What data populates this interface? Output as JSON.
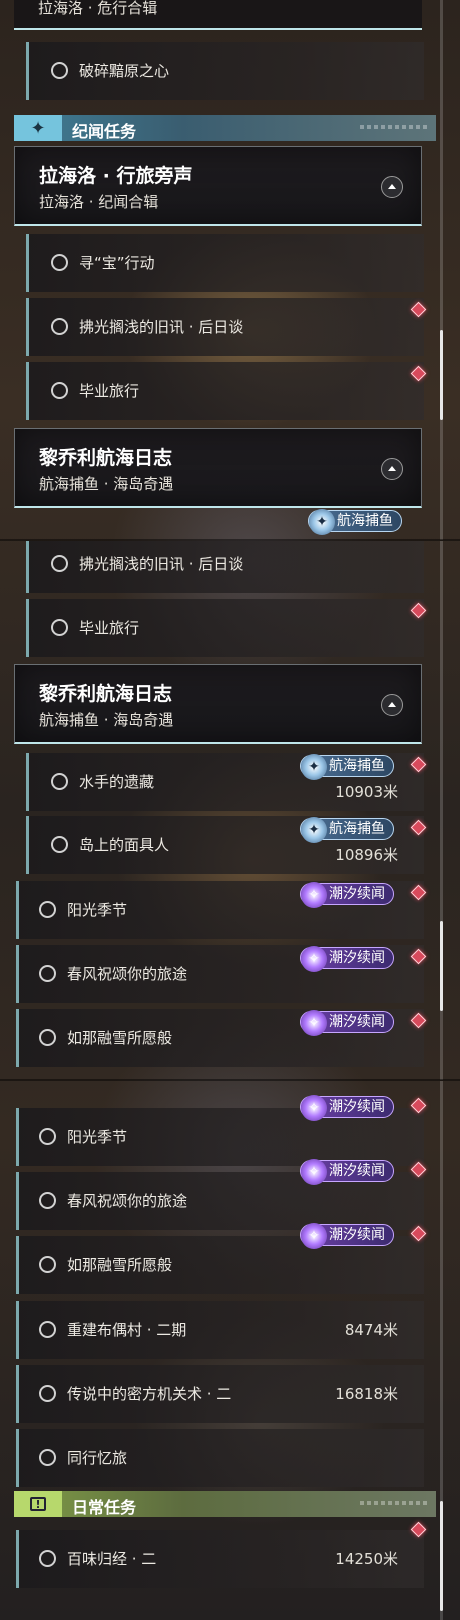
{
  "colors": {
    "accent_teal": "#bfe6ea",
    "marker_red": "#d84a5c",
    "tag_purple": "#6b3fa6",
    "tag_blue": "#4b6f95",
    "section_blue": "#75c4dd",
    "section_green": "#b7d86c"
  },
  "seg1": {
    "top_partial_subtitle": "拉海洛 · 危行合辑",
    "row_broken": "破碎黯原之心",
    "section_jiwen": "纪闻任务",
    "quest1": {
      "title": "拉海洛 · 行旅旁声",
      "subtitle": "拉海洛 · 纪闻合辑"
    },
    "rows": [
      "寻“宝”行动",
      "拂光搁浅的旧讯 · 后日谈",
      "毕业旅行"
    ],
    "quest2": {
      "title": "黎乔利航海日志",
      "subtitle": "航海捕鱼 · 海岛奇遇"
    },
    "partial_tag": "航海捕鱼"
  },
  "seg2": {
    "rows_top": [
      "拂光搁浅的旧讯 · 后日谈",
      "毕业旅行"
    ],
    "quest": {
      "title": "黎乔利航海日志",
      "subtitle": "航海捕鱼 · 海岛奇遇"
    },
    "fishing": [
      {
        "label": "水手的遗藏",
        "tag": "航海捕鱼",
        "distance": "10903米"
      },
      {
        "label": "岛上的面具人",
        "tag": "航海捕鱼",
        "distance": "10896米"
      }
    ],
    "tide": [
      {
        "label": "阳光季节",
        "tag": "潮汐续闻"
      },
      {
        "label": "春风祝颂你的旅途",
        "tag": "潮汐续闻"
      },
      {
        "label": "如那融雪所愿般",
        "tag": "潮汐续闻"
      }
    ]
  },
  "seg3": {
    "tide": [
      {
        "label": "阳光季节",
        "tag": "潮汐续闻"
      },
      {
        "label": "春风祝颂你的旅途",
        "tag": "潮汐续闻"
      },
      {
        "label": "如那融雪所愿般",
        "tag": "潮汐续闻"
      }
    ],
    "rows": [
      {
        "label": "重建布偶村 · 二期",
        "distance": "8474米"
      },
      {
        "label": "传说中的密方机关术 · 二",
        "distance": "16818米"
      },
      {
        "label": "同行忆旅",
        "distance": ""
      }
    ],
    "section_daily": "日常任务",
    "daily": {
      "label": "百味归经 · 二",
      "distance": "14250米"
    }
  },
  "icons": {
    "section_jiwen": "sparkle-icon",
    "section_daily": "exclamation-icon",
    "tag_purple": "tide-icon",
    "tag_blue": "fishing-icon"
  }
}
